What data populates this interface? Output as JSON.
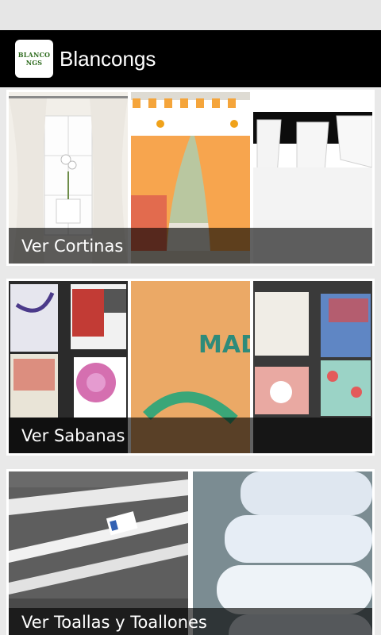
{
  "app": {
    "title": "Blancongs",
    "logo_text_line1": "BLANCO",
    "logo_text_line2": "NGS"
  },
  "categories": [
    {
      "label": "Ver Cortinas"
    },
    {
      "label": "Ver Sabanas"
    },
    {
      "label": "Ver Toallas y Toallones"
    }
  ],
  "colors": {
    "app_bar": "#000000",
    "status_bar": "#e6e6e6",
    "background": "#e9e9e9",
    "overlay": "rgba(0,0,0,0.62)"
  }
}
